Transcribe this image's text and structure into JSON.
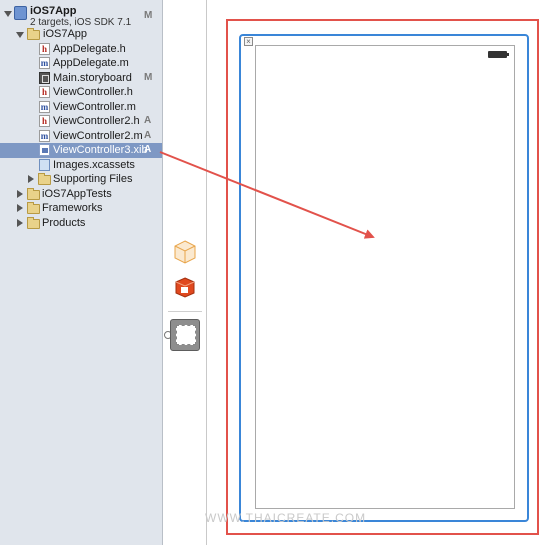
{
  "navigator": {
    "project": {
      "name": "iOS7App",
      "subtitle": "2 targets, iOS SDK 7.1",
      "status": "M"
    },
    "items": [
      {
        "label": "iOS7App",
        "status": ""
      },
      {
        "label": "AppDelegate.h",
        "status": ""
      },
      {
        "label": "AppDelegate.m",
        "status": ""
      },
      {
        "label": "Main.storyboard",
        "status": "M"
      },
      {
        "label": "ViewController.h",
        "status": ""
      },
      {
        "label": "ViewController.m",
        "status": ""
      },
      {
        "label": "ViewController2.h",
        "status": "A"
      },
      {
        "label": "ViewController2.m",
        "status": "A"
      },
      {
        "label": "ViewController3.xib",
        "status": "A"
      },
      {
        "label": "Images.xcassets",
        "status": ""
      },
      {
        "label": "Supporting Files",
        "status": ""
      },
      {
        "label": "iOS7AppTests",
        "status": ""
      },
      {
        "label": "Frameworks",
        "status": ""
      },
      {
        "label": "Products",
        "status": ""
      }
    ]
  },
  "canvas": {
    "close_glyph": "×",
    "watermark": "WWW.THAICREATE.COM"
  },
  "colors": {
    "annotation_red": "#e2524b",
    "selection_blue": "#3a86d8",
    "sidebar_bg": "#e0e5ec",
    "selected_row": "#7e98c4"
  }
}
